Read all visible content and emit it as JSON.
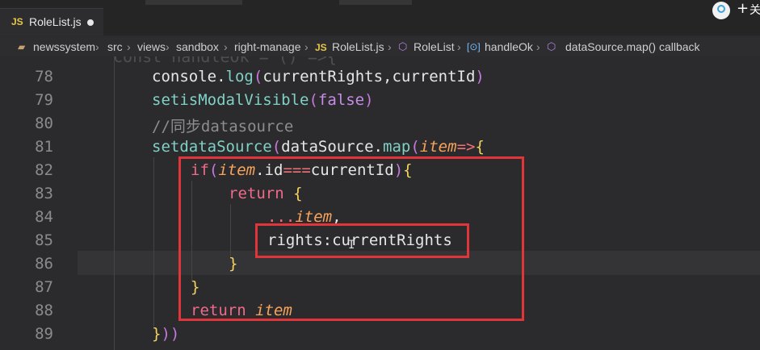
{
  "tab": {
    "lang_badge": "JS",
    "filename": "RoleList.js",
    "modified_indicator": "●"
  },
  "topright": {
    "plus": "+",
    "cut_text": "关"
  },
  "breadcrumb": [
    {
      "t": "newssystem",
      "c": "txt"
    },
    {
      "t": "src",
      "c": "txt"
    },
    {
      "t": "views",
      "c": "txt"
    },
    {
      "t": "sandbox",
      "c": "txt"
    },
    {
      "t": "right-manage",
      "c": "txt"
    },
    {
      "t": "JS",
      "c": "jsb"
    },
    {
      "t": "RoleList.js",
      "c": "txt"
    },
    {
      "t": "RoleList",
      "c": "txt"
    },
    {
      "t": "handleOk",
      "c": "txt"
    },
    {
      "t": "dataSource.map() callback",
      "c": "txt"
    }
  ],
  "ghost_line": "const handleOk = () =>{",
  "lines": [
    {
      "n": "78",
      "indent": 0,
      "html": "console.log(currentRights,currentId)"
    },
    {
      "n": "79",
      "indent": 0,
      "html": "setisModalVisible(false)"
    },
    {
      "n": "80",
      "indent": 0,
      "html": "//同步datasource"
    },
    {
      "n": "81",
      "indent": 0,
      "html": "setdataSource(dataSource.map(item=>{"
    },
    {
      "n": "82",
      "indent": 1,
      "html": "if(item.id===currentId){"
    },
    {
      "n": "83",
      "indent": 2,
      "html": "return {"
    },
    {
      "n": "84",
      "indent": 3,
      "html": "...item,"
    },
    {
      "n": "85",
      "indent": 3,
      "html": "rights:currentRights"
    },
    {
      "n": "86",
      "indent": 2,
      "html": "}"
    },
    {
      "n": "87",
      "indent": 1,
      "html": "}"
    },
    {
      "n": "88",
      "indent": 1,
      "html": "return item"
    },
    {
      "n": "89",
      "indent": 0,
      "html": "}))"
    }
  ],
  "colors": {
    "highlight_box": "#e0353b",
    "background": "#2b2b2d"
  }
}
